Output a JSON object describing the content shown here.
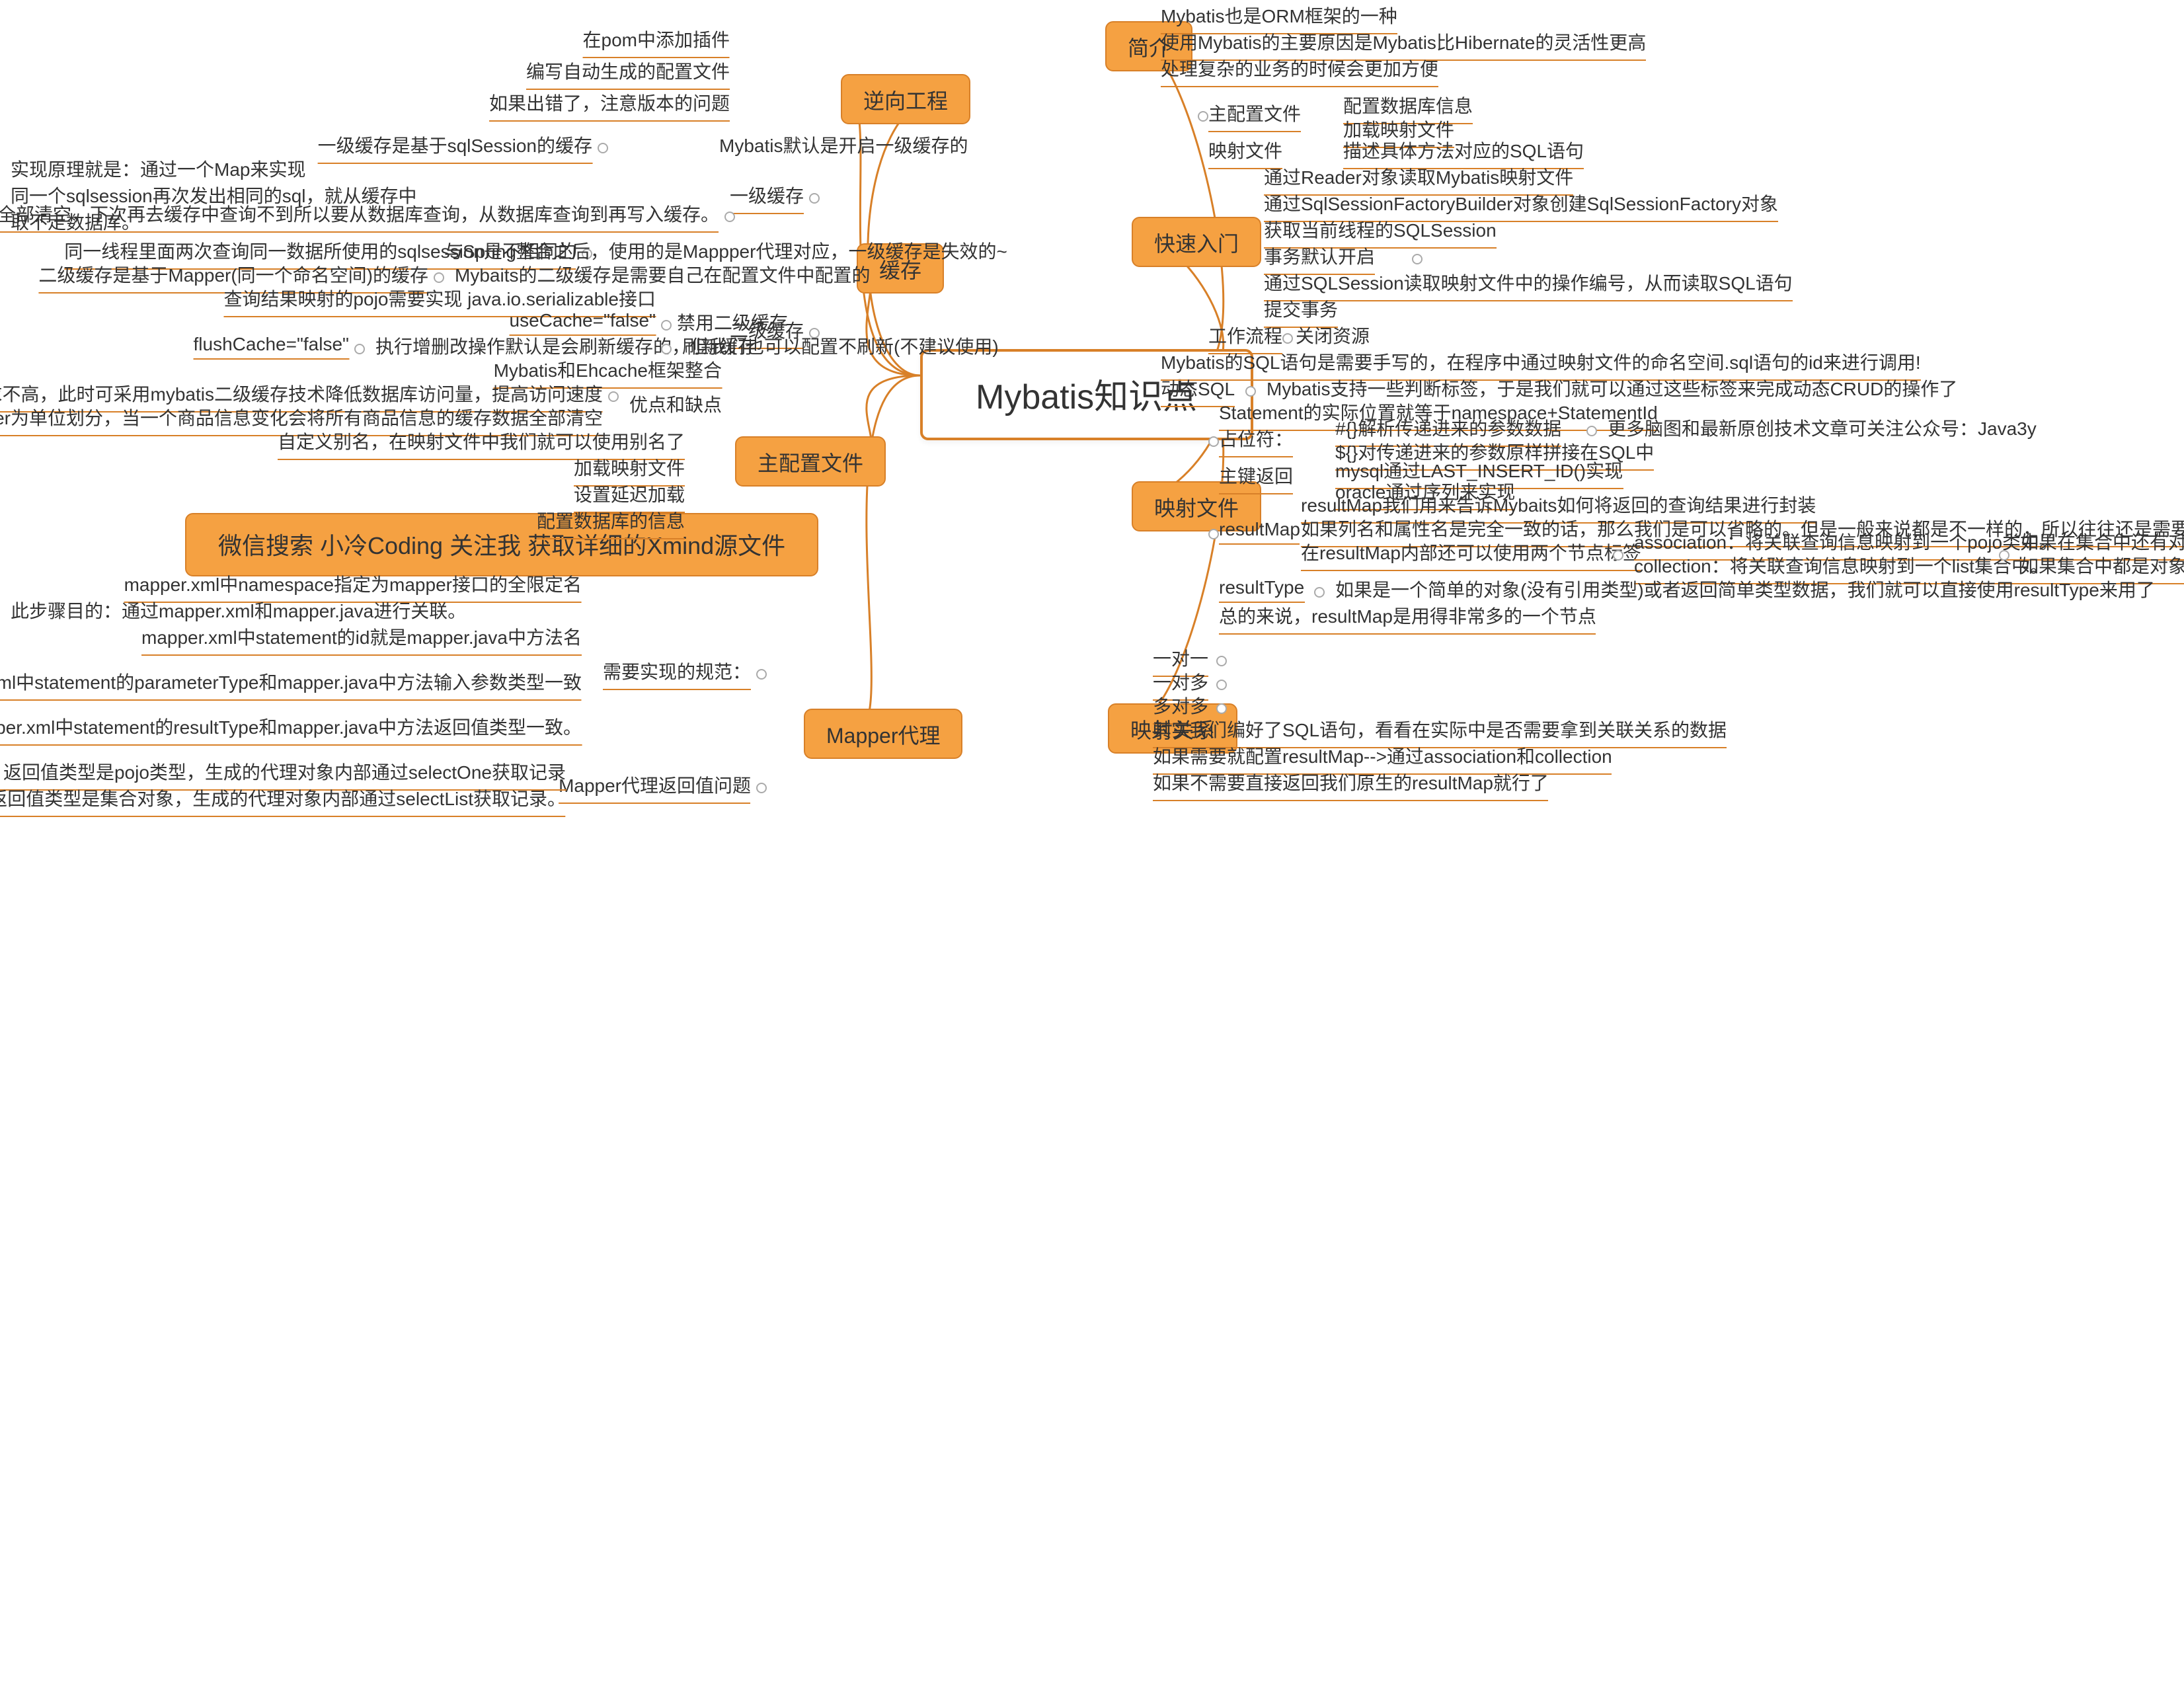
{
  "root": "Mybatis知识点",
  "banner": "微信搜索 小冷Coding 关注我 获取详细的Xmind源文件",
  "left": {
    "reverse": {
      "label": "逆向工程",
      "items": [
        "在pom中添加插件",
        "编写自动生成的配置文件",
        "如果出错了，注意版本的问题"
      ]
    },
    "cache": {
      "label": "缓存",
      "l1": {
        "label": "一级缓存",
        "items": [
          "一级缓存是基于sqlSession的缓存",
          "Mybatis默认是开启一级缓存的",
          "实现原理就是：通过一个Map来实现\n同一个sqlsession再次发出相同的sql，就从缓存中取不走数据库。",
          "如果两次中间出现commit操作（修改、添加、删除），本sqlsession中的一级缓存区域全部清空，下次再去缓存中查询不到所以要从数据库查询，从数据库查询到再写入缓存。"
        ]
      },
      "l2": {
        "label": "二级缓存",
        "hints": [
          "同一线程里面两次查询同一数据所使用的sqlsession是不相同的",
          "与Spring整合之后，使用的是Mappper代理对应，一级缓存是失效的~",
          "二级缓存是基于Mapper(同一个命名空间)的缓存",
          "Mybaits的二级缓存是需要自己在配置文件中配置的",
          "查询结果映射的pojo需要实现 java.io.serializable接口",
          "useCache=\"false\"",
          "禁用二级缓存",
          "flushCache=\"false\"",
          "执行增删改操作默认是会刷新缓存的，但我们也可以配置不刷新(不建议使用)",
          "刷新缓存",
          "Mybatis和Ehcache框架整合",
          "优点：对于访问多的查询请求且用户对查询结果实时性要求不高，此时可采用mybatis二级缓存技术降低数据库访问量，提高访问速度",
          "缺点：因为mybaits的二级缓存区域以mapper为单位划分，当一个商品信息变化会将所有商品信息的缓存数据全部清空",
          "优点和缺点"
        ]
      }
    },
    "config": {
      "label": "主配置文件",
      "items": [
        "自定义别名，在映射文件中我们就可以使用别名了",
        "加载映射文件",
        "设置延迟加载",
        "配置数据库的信息"
      ]
    },
    "mapper": {
      "label": "Mapper代理",
      "needs": {
        "label": "需要实现的规范：",
        "items": [
          "mapper.xml中namespace指定为mapper接口的全限定名",
          "此步骤目的：通过mapper.xml和mapper.java进行关联。",
          "mapper.xml中statement的id就是mapper.java中方法名",
          "mapper.xml中statement的parameterType和mapper.java中方法输入参数类型一致",
          "mapper.xml中statement的resultType和mapper.java中方法返回值类型一致。"
        ]
      },
      "ret": {
        "label": "Mapper代理返回值问题",
        "items": [
          "如果是返回的单个对象，返回值类型是pojo类型，生成的代理对象内部通过selectOne获取记录",
          "如果返回值类型是集合对象，生成的代理对象内部通过selectList获取记录。"
        ]
      }
    }
  },
  "right": {
    "intro": {
      "label": "简介",
      "items": [
        "Mybatis也是ORM框架的一种",
        "使用Mybatis的主要原因是Mybatis比Hibernate的灵活性更高",
        "处理复杂的业务的时候会更加方便"
      ]
    },
    "quick": {
      "label": "快速入门",
      "maincfg": {
        "label": "主配置文件",
        "items": [
          "配置数据库信息",
          "加载映射文件"
        ]
      },
      "mapfile": {
        "label": "映射文件",
        "items": [
          "描述具体方法对应的SQL语句"
        ]
      },
      "flow": {
        "label": "工作流程",
        "items": [
          "通过Reader对象读取Mybatis映射文件",
          "通过SqlSessionFactoryBuilder对象创建SqlSessionFactory对象",
          "获取当前线程的SQLSession",
          "事务默认开启",
          "通过SQLSession读取映射文件中的操作编号，从而读取SQL语句",
          "提交事务",
          "关闭资源"
        ]
      },
      "extra": [
        "Mybatis的SQL语句是需要手写的，在程序中通过映射文件的命名空间.sql语句的id来进行调用!",
        "动态SQL",
        "Mybatis支持一些判断标签，于是我们就可以通过这些标签来完成动态CRUD的操作了"
      ]
    },
    "mapfile": {
      "label": "映射文件",
      "stmt": "Statement的实际位置就等于namespace+StatementId",
      "placeholder": {
        "label": "占位符：",
        "items": [
          "#{}解析传递进来的参数数据",
          "更多脑图和最新原创技术文章可关注公众号：Java3y",
          "${}对传递进来的参数原样拼接在SQL中"
        ]
      },
      "pk": {
        "label": "主键返回",
        "items": [
          "mysql通过LAST_INSERT_ID()实现",
          "oracle通过序列来实现"
        ]
      },
      "resultMap": {
        "label": "resultMap",
        "items": [
          "resultMap我们用来告诉Mybaits如何将返回的查询结果进行封装",
          "如果列名和属性名是完全一致的话，那么我们是可以省略的。但是一般来说都是不一样的，所以往往还是需要resultMap",
          "在resultMap内部还可以使用两个节点标签",
          "association：将关联查询信息映射到一个pojo类中。",
          "collection：将关联查询信息映射到一个list集合中。",
          "如果在集合中还有对象的关系要体现出来的话，那我们只能使用ofType。",
          "如果集合中都是对象本身基本属性了，那么可以使用resultMap"
        ]
      },
      "resultType": {
        "label": "resultType",
        "items": [
          "如果是一个简单的对象(没有引用类型)或者返回简单类型数据，我们就可以直接使用resultType来用了"
        ]
      },
      "summary": "总的来说，resultMap是用得非常多的一个节点"
    },
    "rel": {
      "label": "映射关系",
      "items": [
        "一对一",
        "一对多",
        "多对多",
        "其实我们编好了SQL语句，看看在实际中是否需要拿到关联关系的数据",
        "如果需要就配置resultMap-->通过association和collection",
        "如果不需要直接返回我们原生的resultMap就行了"
      ]
    }
  }
}
